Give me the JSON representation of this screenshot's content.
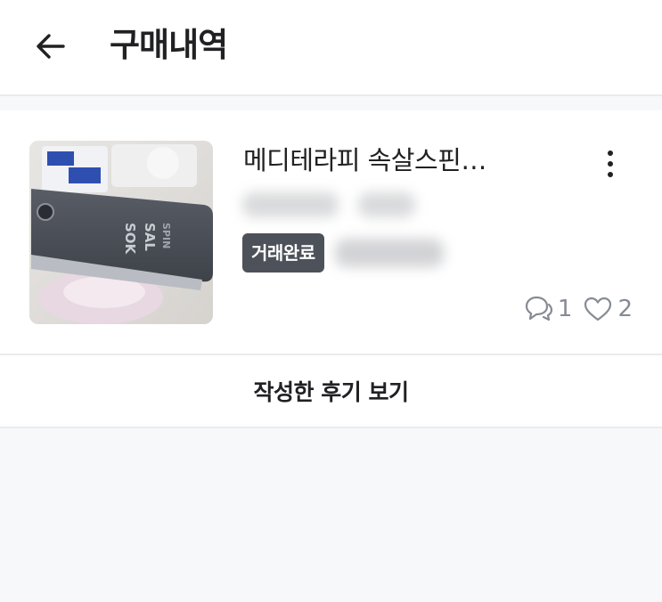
{
  "header": {
    "back_icon": "arrow-left-icon",
    "title": "구매내역"
  },
  "purchase_item": {
    "thumbnail_icon": "product-photo",
    "thumbnail_text": [
      "SOK",
      "SAL",
      "SPIN"
    ],
    "title": "메디테라피 속살스핀…",
    "more_icon": "more-vertical-icon",
    "status_badge": "거래완료",
    "comment_icon": "chat-bubble-icon",
    "comment_count": "1",
    "like_icon": "heart-icon",
    "like_count": "2"
  },
  "review_button": {
    "label": "작성한 후기 보기"
  },
  "colors": {
    "badge_bg": "#4d5159",
    "muted_text": "#868b94",
    "divider": "#eaebee",
    "page_bg": "#f7f8f9"
  }
}
